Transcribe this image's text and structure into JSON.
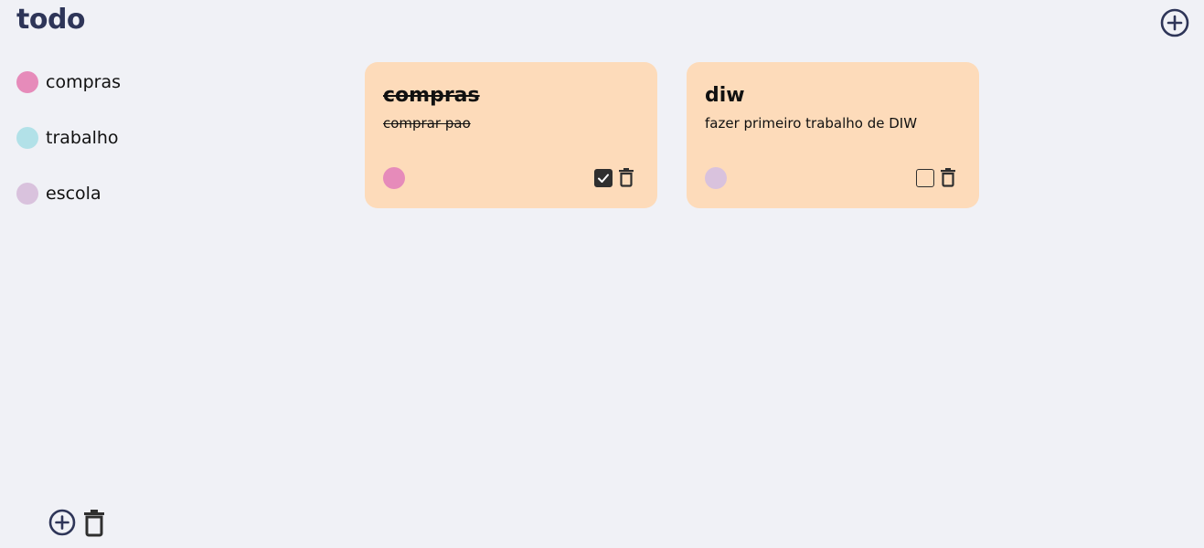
{
  "header": {
    "title": "todo",
    "add_icon": "plus-circle-icon"
  },
  "sidebar": {
    "categories": [
      {
        "label": "compras",
        "color": "#e68bba"
      },
      {
        "label": "trabalho",
        "color": "#b2e1e8"
      },
      {
        "label": "escola",
        "color": "#d9c2dd"
      }
    ],
    "footer_icons": [
      "plus-circle-icon",
      "trash-icon"
    ]
  },
  "notes": [
    {
      "title": "compras",
      "text": "comprar pao",
      "color": "#e68bba",
      "done": true,
      "background": "#fddbba"
    },
    {
      "title": "diw",
      "text": "fazer primeiro trabalho de DIW",
      "color": "#d9c2dd",
      "done": false,
      "background": "#fddbba"
    }
  ],
  "colors": {
    "background": "#f0f1f6",
    "accent": "#2e3558",
    "icon": "#2f2f2f"
  }
}
